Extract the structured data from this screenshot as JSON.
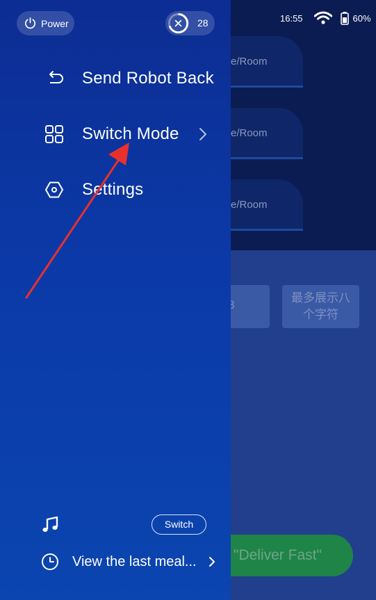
{
  "status_bar": {
    "time": "16:55",
    "battery": "60%"
  },
  "drawer": {
    "power_label": "Power",
    "timer_count": "28",
    "menu": {
      "send_back": "Send Robot Back",
      "switch_mode": "Switch Mode",
      "settings": "Settings"
    },
    "music_switch_label": "Switch",
    "last_meal_label": "View the last meal..."
  },
  "background": {
    "card_labels": [
      "e/Room",
      "e/Room",
      "e/Room"
    ],
    "chip_partial": "8",
    "chip_label": "最多展示八个字符",
    "chip_line1": "最多展示八",
    "chip_line2": "个字符",
    "deliver_button": "\"Deliver Fast\""
  },
  "colors": {
    "annotation_arrow": "#e8312d",
    "drawer_top": "#0c2d93",
    "drawer_bottom": "#0b45b0"
  }
}
